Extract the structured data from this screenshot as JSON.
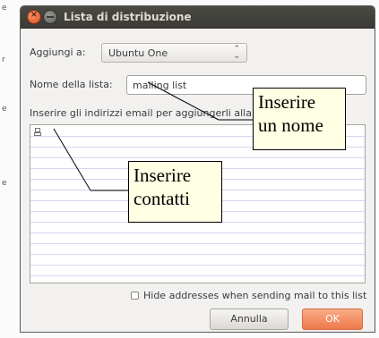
{
  "background_stub": [
    "e",
    "r",
    "e",
    "e"
  ],
  "dialog": {
    "title": "Lista di distribuzione",
    "add_to": {
      "label": "Aggiungi a:",
      "value": "Ubuntu One"
    },
    "list_name": {
      "label": "Nome della lista:",
      "value": "mailing list"
    },
    "instructions": "Inserire gli indirizzi email per aggiungerli alla",
    "hide_addresses_label": "Hide addresses when sending mail to this list",
    "hide_addresses_checked": false,
    "cancel_label": "Annulla",
    "ok_label": "OK"
  },
  "callouts": {
    "name": {
      "line1": "Inserire",
      "line2": "un nome"
    },
    "contacts": {
      "line1": "Inserire",
      "line2": "contatti"
    }
  },
  "colors": {
    "titlebar": "#3c3b37",
    "accent_ok": "#ee7a4c",
    "callout_bg": "#ffffe4",
    "list_rule": "#d6d6f0"
  },
  "icons": {
    "close": "close-icon",
    "minimize": "minimize-icon",
    "row": "person-icon",
    "combo": "chevron-updown-icon"
  }
}
